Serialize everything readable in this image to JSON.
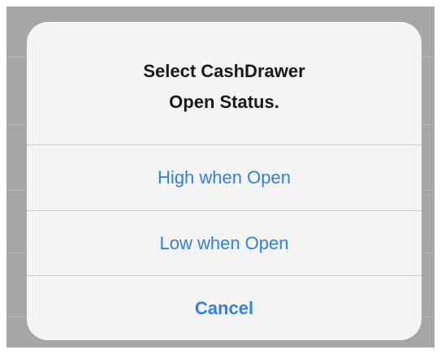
{
  "alert": {
    "title": "Select CashDrawer\nOpen Status.",
    "actions": [
      {
        "label": "High when Open",
        "style": "default"
      },
      {
        "label": "Low when Open",
        "style": "default"
      },
      {
        "label": "Cancel",
        "style": "cancel"
      }
    ]
  },
  "colors": {
    "accent": "#2f80e8",
    "alert_background": "#f4f4f4",
    "dimmed_backdrop": "#a6a6a6",
    "divider": "#cfcfcf",
    "title_text": "#1a1a1a"
  }
}
